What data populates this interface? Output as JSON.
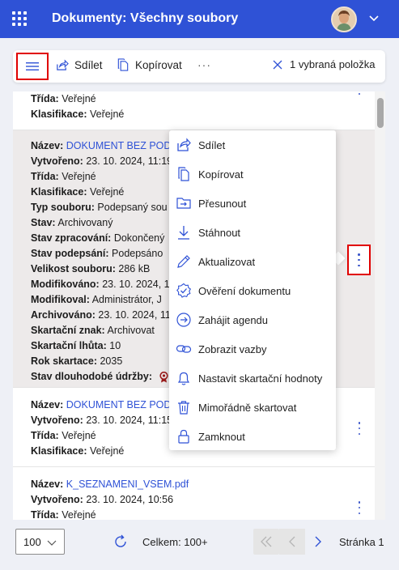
{
  "header": {
    "title": "Dokumenty: Všechny soubory"
  },
  "toolbar": {
    "share": "Sdílet",
    "copy": "Kopírovat",
    "more": "···",
    "selection": "1 vybraná položka"
  },
  "cards": [
    {
      "rows": [
        {
          "label": "Třída:",
          "value": "Veřejné"
        },
        {
          "label": "Klasifikace:",
          "value": "Veřejné"
        }
      ]
    },
    {
      "rows": [
        {
          "label": "Název:",
          "value": "DOKUMENT BEZ POD"
        },
        {
          "label": "Vytvořeno:",
          "value": "23. 10. 2024, 11:19"
        },
        {
          "label": "Třída:",
          "value": "Veřejné"
        },
        {
          "label": "Klasifikace:",
          "value": "Veřejné"
        },
        {
          "label": "Typ souboru:",
          "value": "Podepsaný sou"
        },
        {
          "label": "Stav:",
          "value": "Archivovaný"
        },
        {
          "label": "Stav zpracování:",
          "value": "Dokončený"
        },
        {
          "label": "Stav podepsání:",
          "value": "Podepsáno"
        },
        {
          "label": "Velikost souboru:",
          "value": "286 kB"
        },
        {
          "label": "Modifikováno:",
          "value": "23. 10. 2024, 1"
        },
        {
          "label": "Modifikoval:",
          "value": "Administrátor, J"
        },
        {
          "label": "Archivováno:",
          "value": "23. 10. 2024, 11"
        },
        {
          "label": "Skartační znak:",
          "value": "Archivovat"
        },
        {
          "label": "Skartační lhůta:",
          "value": "10"
        },
        {
          "label": "Rok skartace:",
          "value": "2035"
        },
        {
          "label": "Stav dlouhodobé údržby:",
          "value": ""
        }
      ]
    },
    {
      "rows": [
        {
          "label": "Název:",
          "value": "DOKUMENT BEZ POD"
        },
        {
          "label": "Vytvořeno:",
          "value": "23. 10. 2024, 11:15"
        },
        {
          "label": "Třída:",
          "value": "Veřejné"
        },
        {
          "label": "Klasifikace:",
          "value": "Veřejné"
        }
      ]
    },
    {
      "rows": [
        {
          "label": "Název:",
          "value": "K_SEZNAMENI_VSEM.pdf"
        },
        {
          "label": "Vytvořeno:",
          "value": "23. 10. 2024, 10:56"
        },
        {
          "label": "Třída:",
          "value": "Veřejné"
        }
      ]
    }
  ],
  "context_menu": [
    {
      "label": "Sdílet",
      "icon": "share-icon"
    },
    {
      "label": "Kopírovat",
      "icon": "copy-icon"
    },
    {
      "label": "Přesunout",
      "icon": "move-icon"
    },
    {
      "label": "Stáhnout",
      "icon": "download-icon"
    },
    {
      "label": "Aktualizovat",
      "icon": "pencil-icon"
    },
    {
      "label": "Ověření dokumentu",
      "icon": "verified-badge-icon"
    },
    {
      "label": "Zahájit agendu",
      "icon": "arrow-circle-icon"
    },
    {
      "label": "Zobrazit vazby",
      "icon": "link-icon"
    },
    {
      "label": "Nastavit skartační hodnoty",
      "icon": "bell-icon"
    },
    {
      "label": "Mimořádně skartovat",
      "icon": "trash-icon"
    },
    {
      "label": "Zamknout",
      "icon": "lock-icon"
    }
  ],
  "footer": {
    "page_size": "100",
    "total": "Celkem: 100+",
    "page": "Stránka 1"
  },
  "colors": {
    "brand": "#2f52d6",
    "highlight": "#e00000",
    "selected_row": "#edeaea"
  }
}
